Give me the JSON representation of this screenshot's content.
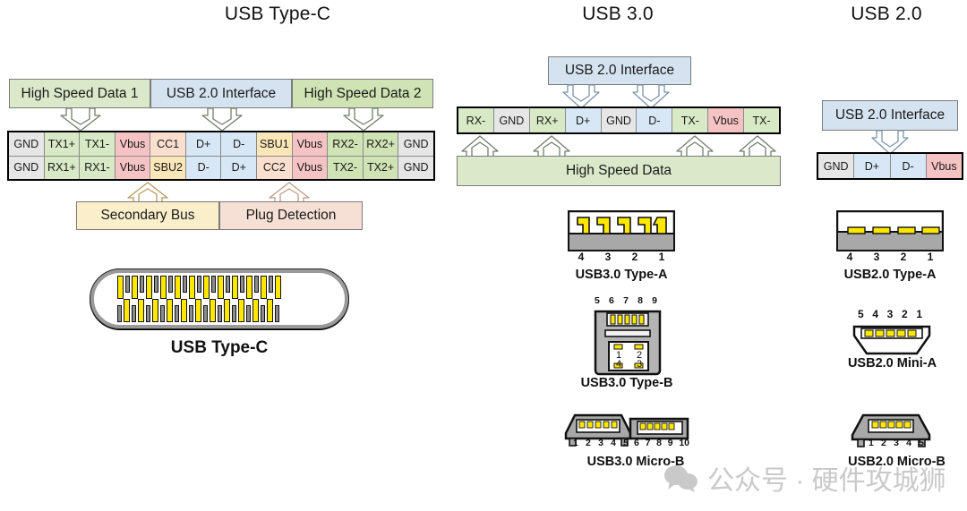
{
  "titles": {
    "type_c": "USB Type-C",
    "usb30": "USB 3.0",
    "usb20": "USB 2.0"
  },
  "type_c": {
    "headers": [
      {
        "label": "High Speed Data 1",
        "color": "#dbe8ca"
      },
      {
        "label": "USB 2.0 Interface",
        "color": "#d5e3f1"
      },
      {
        "label": "High Speed Data 2",
        "color": "#cfe3b4"
      }
    ],
    "pin_rows": [
      [
        "GND",
        "TX1+",
        "TX1-",
        "Vbus",
        "CC1",
        "D+",
        "D-",
        "SBU1",
        "Vbus",
        "RX2-",
        "RX2+",
        "GND"
      ],
      [
        "GND",
        "RX1+",
        "RX1-",
        "Vbus",
        "SBU2",
        "D-",
        "D+",
        "CC2",
        "Vbus",
        "TX2-",
        "TX2+",
        "GND"
      ]
    ],
    "footers": [
      {
        "label": "Secondary Bus",
        "color": "#fbeeca"
      },
      {
        "label": "Plug Detection",
        "color": "#f6e0d6"
      }
    ],
    "connector_label": "USB Type-C"
  },
  "usb30": {
    "top_box": "USB 2.0 Interface",
    "pins": [
      "RX-",
      "GND",
      "RX+",
      "D+",
      "GND",
      "D-",
      "TX-",
      "Vbus",
      "TX-"
    ],
    "bottom_box": "High Speed Data",
    "connectors": [
      {
        "label": "USB3.0 Type-A",
        "numbers": [
          "4",
          "3",
          "2",
          "1"
        ]
      },
      {
        "label": "USB3.0 Type-B",
        "numbers_top": [
          "5",
          "6",
          "7",
          "8",
          "9"
        ],
        "numbers_inner": [
          "1",
          "2",
          "4",
          "3"
        ]
      },
      {
        "label": "USB3.0 Micro-B",
        "numbers_left": [
          "1",
          "2",
          "3",
          "4",
          "5"
        ],
        "numbers_right": [
          "6",
          "7",
          "8",
          "9",
          "10"
        ]
      }
    ]
  },
  "usb20": {
    "top_box": "USB 2.0 Interface",
    "pins": [
      "GND",
      "D+",
      "D-",
      "Vbus"
    ],
    "connectors": [
      {
        "label": "USB2.0 Type-A",
        "numbers": [
          "4",
          "3",
          "2",
          "1"
        ]
      },
      {
        "label": "USB2.0 Mini-A",
        "numbers": [
          "5",
          "4",
          "3",
          "2",
          "1"
        ]
      },
      {
        "label": "USB2.0 Micro-B",
        "numbers": [
          "1",
          "2",
          "3",
          "4",
          "5"
        ]
      }
    ]
  },
  "watermark": {
    "text": "公众号 · 硬件攻城狮"
  },
  "colors": {
    "gnd": "#e6e6e6",
    "data_green": "#d8e9c6",
    "data_green2": "#cfe3b4",
    "vbus_red": "#f6c3c5",
    "usb2_blue": "#d8e7f5",
    "sbu_yellow": "#fbe6b8",
    "cc_peach": "#fadfce",
    "pin_yellow": "#ffe800",
    "shell_gray": "#9a9a9a"
  }
}
